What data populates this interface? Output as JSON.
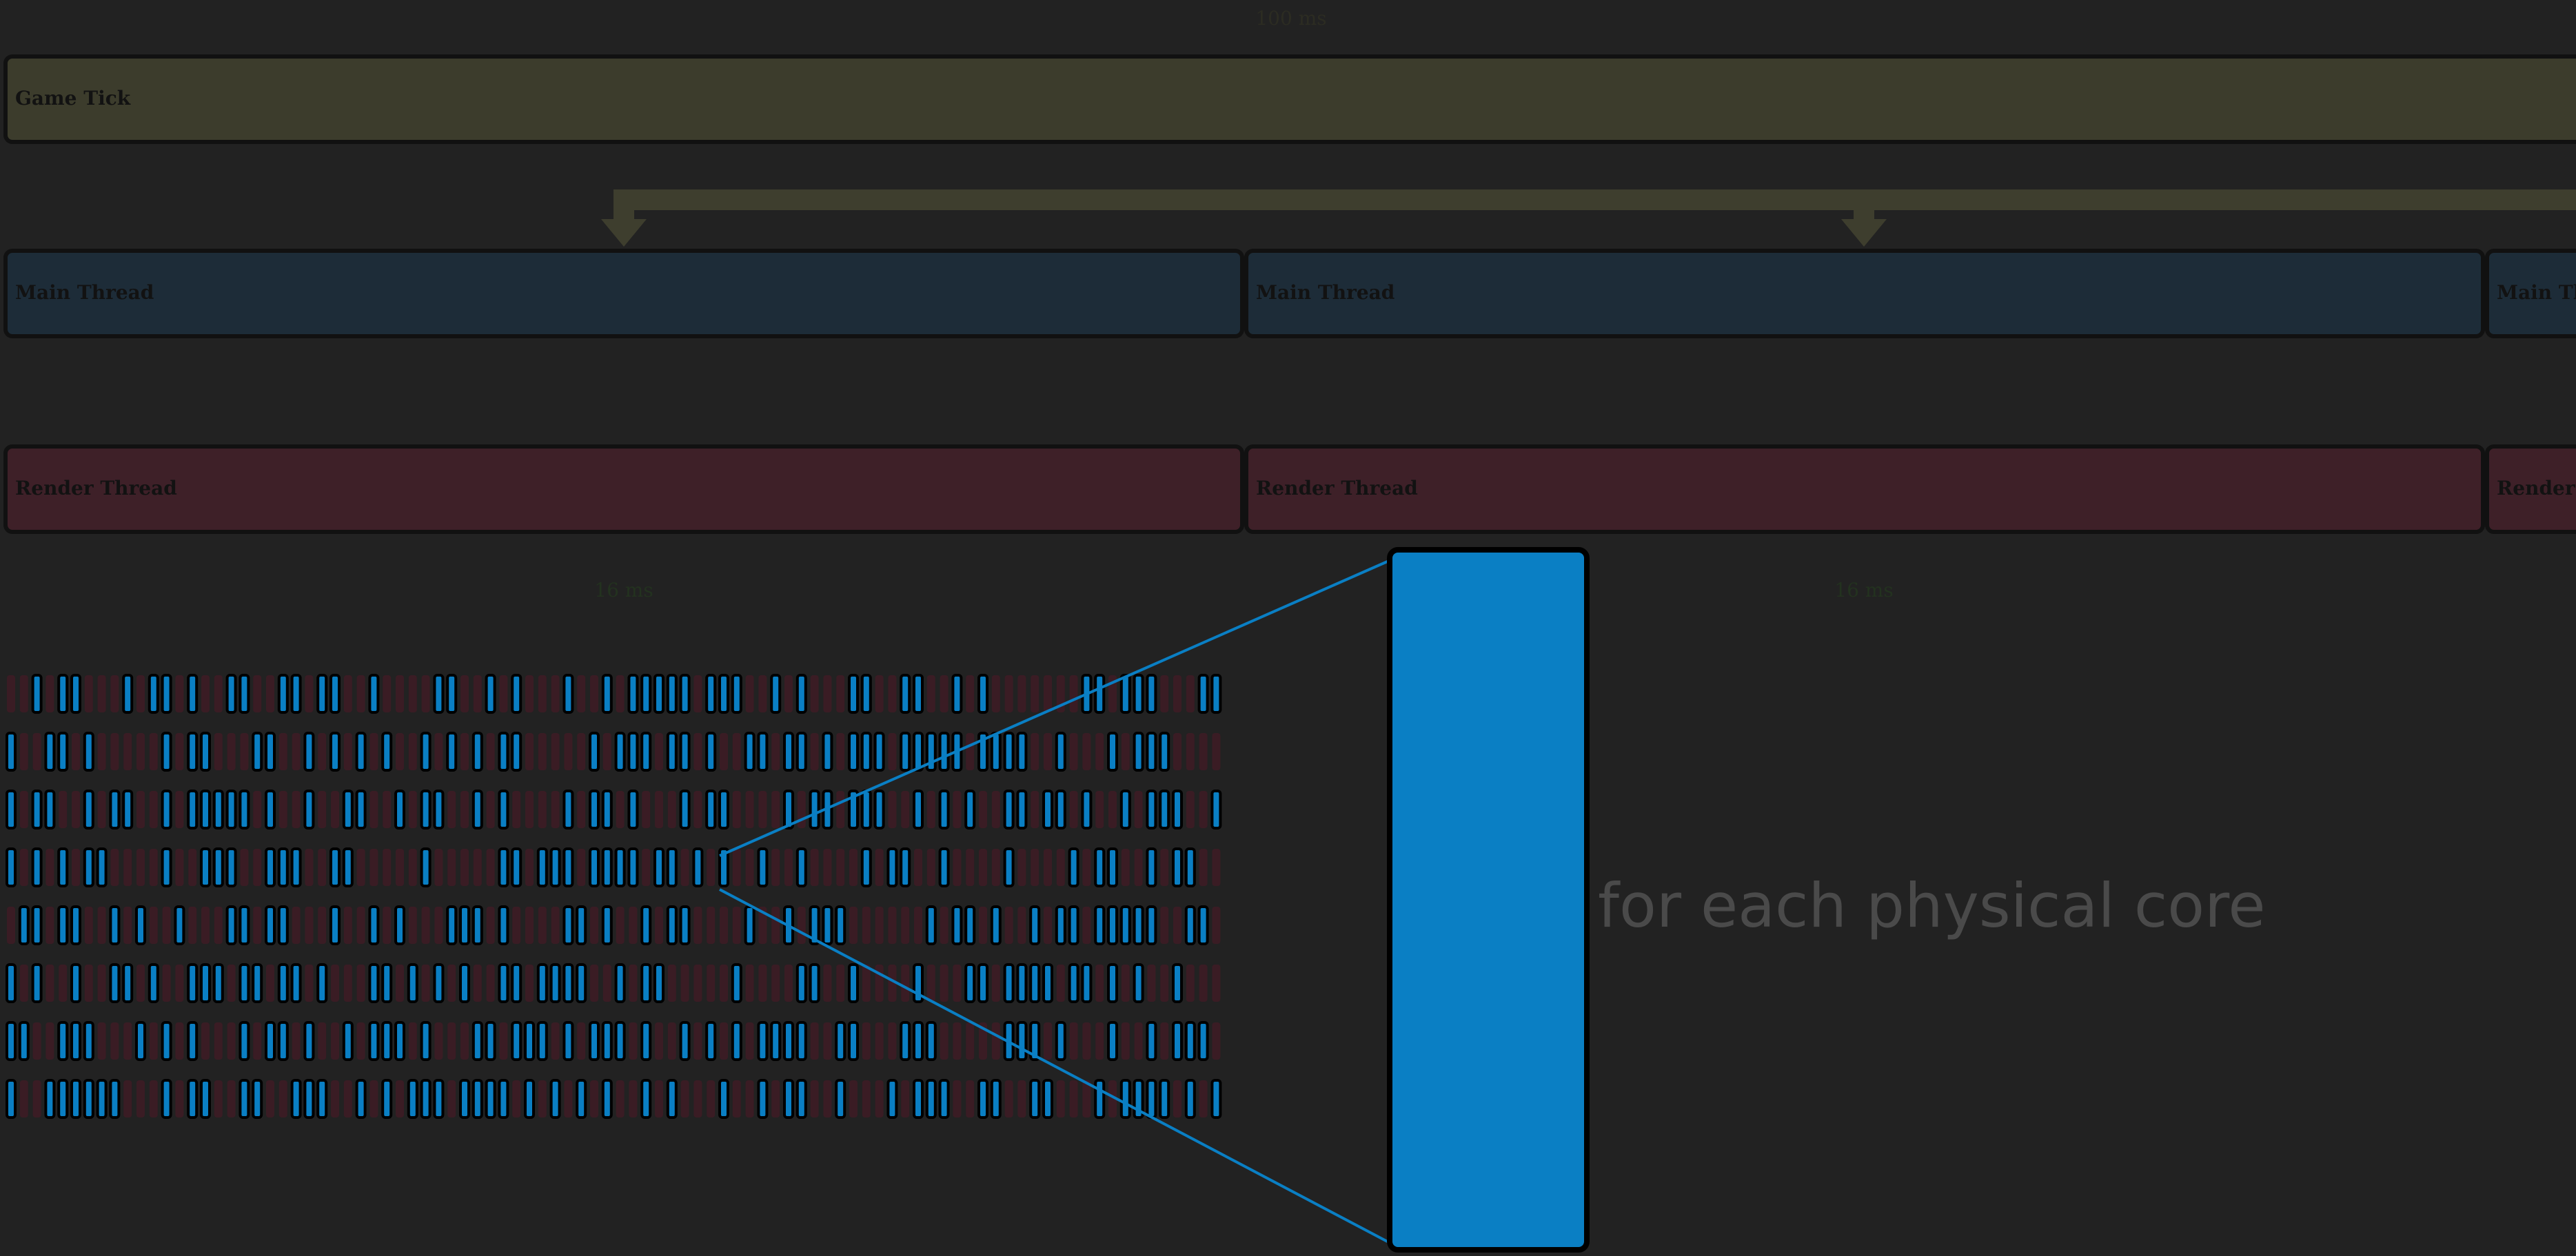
{
  "colors": {
    "background": "#222222",
    "tick_fill": "#3c3c2c",
    "tick_arrow": "#3e3e2e",
    "main_fill": "#1d2c38",
    "render_fill": "#3e2028",
    "lane_border": "#111111",
    "lane_text": "#121212",
    "dim_text_top": "#2c2c22",
    "dim_text_frame": "#23321f",
    "core_text": "#4a4a4a",
    "job_fill": "#0a7fc4",
    "job_stroke": "#000000",
    "ghost_fill": "#3a1c24",
    "zoom_line": "#0a7fc4"
  },
  "timeline": {
    "total_duration_label": "100 ms",
    "game_tick": {
      "label": "Game Tick"
    },
    "frames": [
      {
        "main_label": "Main Thread",
        "render_label": "Render Thread",
        "duration_label": "16 ms"
      },
      {
        "main_label": "Main Thread",
        "render_label": "Render Thread",
        "duration_label": "16 ms"
      },
      {
        "main_label": "Main Thread",
        "render_label": "Render Thread"
      }
    ]
  },
  "jobs_grid": {
    "rows": [
      "0010110001011010011001101100100001100101000100101111101110010100011001100101000000011011100011",
      "1001101000001011000110010101010010101011000001011101101001101101011101111101111001000101110000",
      "1011001011001011111010010011001011001010000101101000101100001011011100101010011011010010111001",
      "1010101100001001110011100110000010000011011101111011010100100100001011001000010000101100101100",
      "0110110010100100011011000100101000111010000110100101100001001011100000010110100101101111100110",
      "1010010011010011101101101000110101010011011110010110000010000110010000100011011110110101001000",
      "1100111000101010001011010010111010001101110101110100101010111100110001110000011101000100101110",
      "1001111110001011001100111001010111011110101010100101000100101100100010111001100110001011110101"
    ]
  },
  "zoom": {
    "caption": "for each physical core"
  }
}
